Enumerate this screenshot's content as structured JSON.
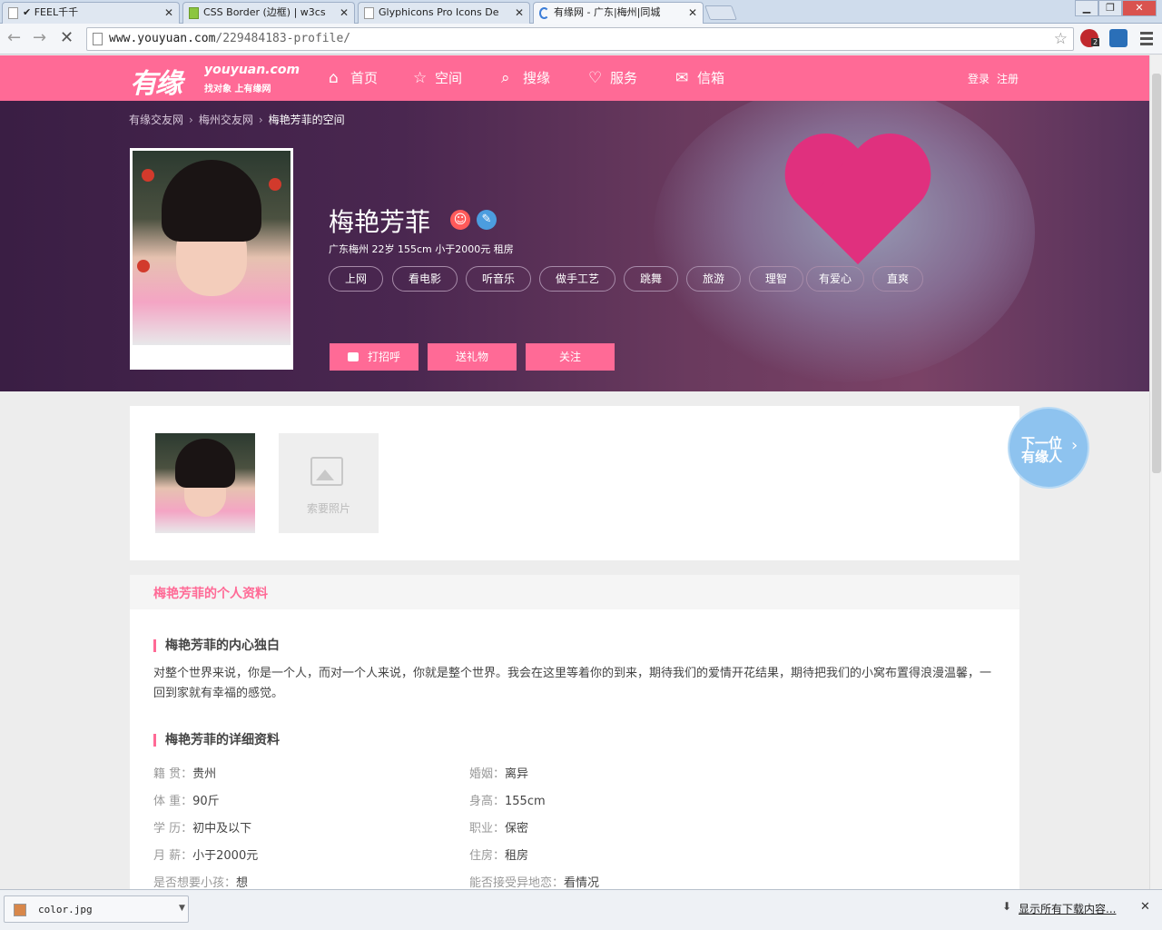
{
  "browser": {
    "tabs": [
      {
        "title": "✔ FEEL千千",
        "active": false
      },
      {
        "title": "CSS Border (边框) | w3cs",
        "active": false
      },
      {
        "title": "Glyphicons Pro Icons De",
        "active": false
      },
      {
        "title": "有缘网 - 广东|梅州|同城",
        "active": true
      }
    ],
    "url_host": "www.youyuan.com",
    "url_path": "/229484183-profile/",
    "extension_badge": "2"
  },
  "site": {
    "logo_cn": "有缘",
    "logo_en": "youyuan.com",
    "logo_tagline": "找对象 上有缘网",
    "nav": [
      {
        "label": "首页",
        "icon": "home-icon"
      },
      {
        "label": "空间",
        "icon": "star-icon"
      },
      {
        "label": "搜缘",
        "icon": "search-icon"
      },
      {
        "label": "服务",
        "icon": "heart-icon"
      },
      {
        "label": "信箱",
        "icon": "mail-icon"
      }
    ],
    "login": "登录",
    "register": "注册"
  },
  "hero": {
    "breadcrumb": [
      "有缘交友网",
      "梅州交友网",
      "梅艳芳菲的空间"
    ],
    "name": "梅艳芳菲",
    "info": "广东梅州 22岁 155cm 小于2000元 租房",
    "tags": [
      "上网",
      "看电影",
      "听音乐",
      "做手工艺",
      "跳舞",
      "旅游",
      "理智",
      "有爱心",
      "直爽"
    ],
    "actions": [
      "打招呼",
      "送礼物",
      "关注"
    ]
  },
  "gallery": {
    "ask_photo": "索要照片",
    "next_line1": "下一位",
    "next_line2": "有缘人"
  },
  "profile": {
    "header": "梅艳芳菲的个人资料",
    "monologue_title": "梅艳芳菲的内心独白",
    "monologue": "对整个世界来说，你是一个人，而对一个人来说，你就是整个世界。我会在这里等着你的到来，期待我们的爱情开花结果，期待把我们的小窝布置得浪漫温馨，一回到家就有幸福的感觉。",
    "details_title": "梅艳芳菲的详细资料",
    "fields": [
      {
        "k": "籍 贯：",
        "v": "贵州"
      },
      {
        "k": "婚姻：",
        "v": "离异"
      },
      {
        "k": "体 重：",
        "v": "90斤"
      },
      {
        "k": "身高：",
        "v": "155cm"
      },
      {
        "k": "学 历：",
        "v": "初中及以下"
      },
      {
        "k": "职业：",
        "v": "保密"
      },
      {
        "k": "月 薪：",
        "v": "小于2000元"
      },
      {
        "k": "住房：",
        "v": "租房"
      },
      {
        "k": "是否想要小孩：",
        "v": "想"
      },
      {
        "k": "能否接受异地恋：",
        "v": "看情况"
      }
    ]
  },
  "downloads": {
    "file": "color.jpg",
    "show_all": "显示所有下载内容..."
  }
}
